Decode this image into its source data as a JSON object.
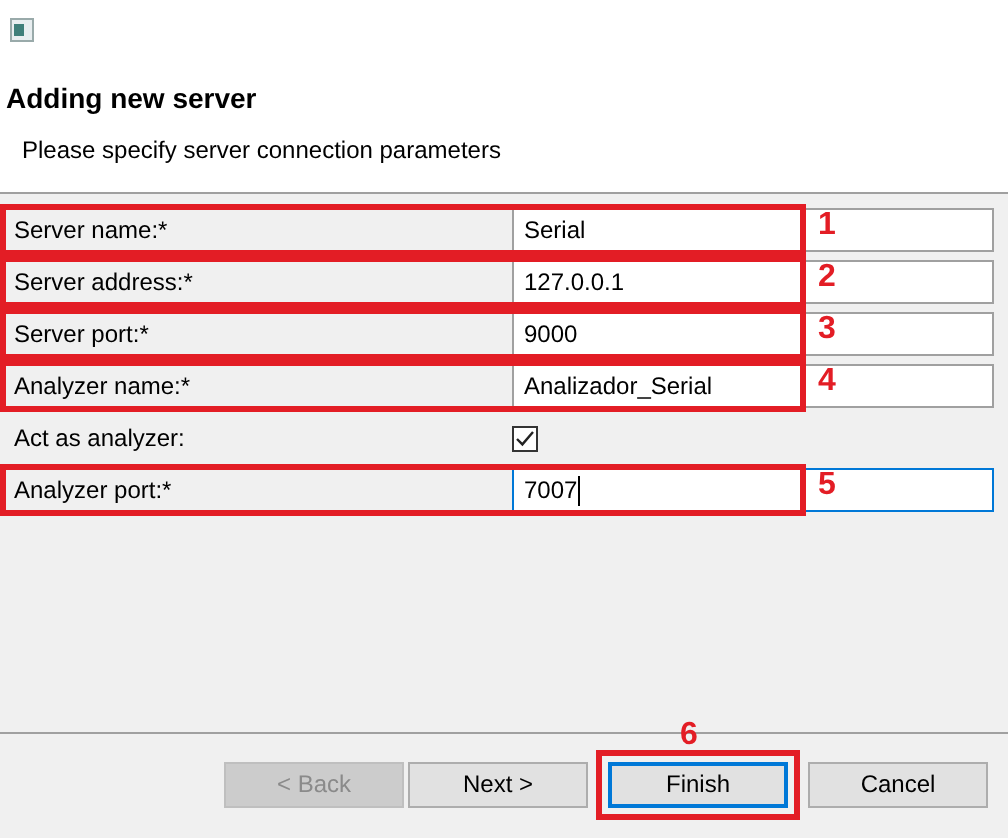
{
  "header": {
    "title": "Adding new server",
    "subtitle": "Please specify server connection parameters"
  },
  "fields": [
    {
      "kind": "text",
      "label": "Server name:*",
      "value": "Serial",
      "focused": false,
      "annotation": "1"
    },
    {
      "kind": "text",
      "label": "Server address:*",
      "value": "127.0.0.1",
      "focused": false,
      "annotation": "2"
    },
    {
      "kind": "text",
      "label": "Server port:*",
      "value": "9000",
      "focused": false,
      "annotation": "3"
    },
    {
      "kind": "text",
      "label": "Analyzer name:*",
      "value": "Analizador_Serial",
      "focused": false,
      "annotation": "4"
    },
    {
      "kind": "checkbox",
      "label": "Act as analyzer:",
      "checked": true
    },
    {
      "kind": "text",
      "label": "Analyzer port:*",
      "value": "7007",
      "focused": true,
      "annotation": "5"
    }
  ],
  "buttons": [
    {
      "label": "< Back",
      "disabled": true,
      "default": false
    },
    {
      "label": "Next >",
      "disabled": false,
      "default": false
    },
    {
      "label": "Finish",
      "disabled": false,
      "default": true,
      "annotation": "6"
    },
    {
      "label": "Cancel",
      "disabled": false,
      "default": false
    }
  ]
}
